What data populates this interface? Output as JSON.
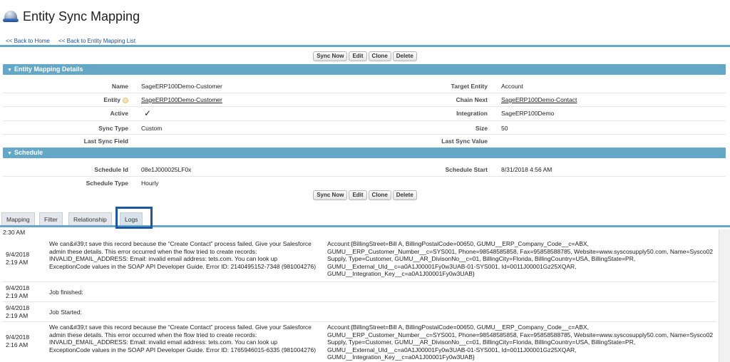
{
  "header": {
    "title": "Entity Sync Mapping"
  },
  "nav": {
    "back_home": "<< Back to Home",
    "back_list": "<< Back to Entity Mapping List"
  },
  "buttons": {
    "sync_now": "Sync Now",
    "edit": "Edit",
    "clone": "Clone",
    "delete": "Delete"
  },
  "sections": {
    "details": "Entity Mapping Details",
    "schedule": "Schedule"
  },
  "details": {
    "name_label": "Name",
    "name_value": "SageERP100Demo-Customer",
    "entity_label": "Entity",
    "entity_value": "SageERP100Demo-Customer",
    "active_label": "Active",
    "active_value": "✓",
    "sync_type_label": "Sync Type",
    "sync_type_value": "Custom",
    "last_sync_field_label": "Last Sync Field",
    "target_entity_label": "Target Entity",
    "target_entity_value": "Account",
    "chain_next_label": "Chain Next",
    "chain_next_value": "SageERP100Demo-Contact",
    "integration_label": "Integration",
    "integration_value": "SageERP100Demo",
    "size_label": "Size",
    "size_value": "50",
    "last_sync_value_label": "Last Sync Value"
  },
  "schedule": {
    "id_label": "Schedule Id",
    "id_value": "08e1J000025LF0x",
    "type_label": "Schedule Type",
    "type_value": "Hourly",
    "start_label": "Schedule Start",
    "start_value": "8/31/2018 4:56 AM"
  },
  "tabs": [
    "Mapping",
    "Filter",
    "Relationship",
    "Logs"
  ],
  "logs": {
    "top_partial": "2:30 AM",
    "rows": [
      {
        "date": "9/4/2018",
        "time": "2:19 AM",
        "message": "We can&#39;t save this record because the “Create Contact” process failed. Give your Salesforce admin these details. This error occurred when the flow tried to create records: INVALID_EMAIL_ADDRESS: Email: invalid email address: tets.com. You can look up ExceptionCode values in the SOAP API Developer Guide. Error ID: 2140495152-7348 (981004276)",
        "data": "Account:{BillingStreet=Bill A, BillingPostalCode=00650, GUMU__ERP_Company_Code__c=ABX, GUMU__ERP_Customer_Number__c=SYS001, Phone=98548585858, Fax=95858588785, Website=www.syscosupply50.com, Name=Sysco02 Supply, Type=Customer, GUMU__AR_DivisonNo__c=01, BillingCity=Florida, BillingCountry=USA, BillingState=PR, GUMU__External_UId__c=a0A1J00001Fy0w3UAB-01-SYS001, Id=0011J00001Gz25XQAR, GUMU__Integration_Key__c=a0A1J00001Fy0w3UAB}"
      },
      {
        "date": "9/4/2018",
        "time": "2:19 AM",
        "message": "Job finished:",
        "data": ""
      },
      {
        "date": "9/4/2018",
        "time": "2:19 AM",
        "message": "Job Started:",
        "data": ""
      },
      {
        "date": "9/4/2018",
        "time": "2:16 AM",
        "message": "We can&#39;t save this record because the “Create Contact” process failed. Give your Salesforce admin these details. This error occurred when the flow tried to create records: INVALID_EMAIL_ADDRESS: Email: invalid email address: tets.com. You can look up ExceptionCode values in the SOAP API Developer Guide. Error ID: 1765946015-6335 (981004276)",
        "data": "Account:{BillingStreet=Bill A, BillingPostalCode=00650, GUMU__ERP_Company_Code__c=ABX, GUMU__ERP_Customer_Number__c=SYS001, Phone=98548585858, Fax=95858588785, Website=www.syscosupply50.com, Name=Sysco02 Supply, Type=Customer, GUMU__AR_DivisonNo__c=01, BillingCity=Florida, BillingCountry=USA, BillingState=PR, GUMU__External_UId__c=a0A1J00001Fy0w3UAB-01-SYS001, Id=0011J00001Gz25XQAR, GUMU__Integration_Key__c=a0A1J00001Fy0w3UAB}"
      }
    ]
  },
  "colors": {
    "section": "#64a7c6",
    "highlight": "#1c56a8"
  }
}
